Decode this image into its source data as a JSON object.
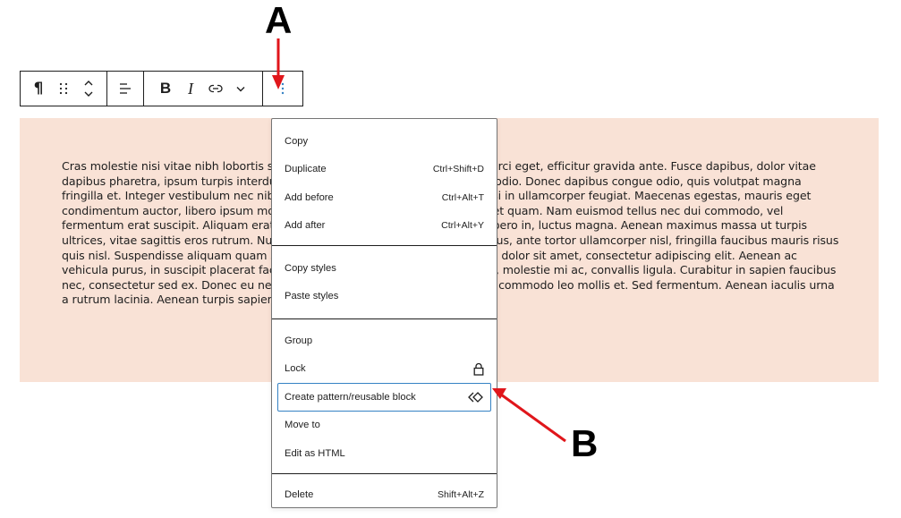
{
  "annotations": {
    "label_a": "A",
    "label_b": "B",
    "arrow_color": "#e0161b"
  },
  "toolbar": {
    "paragraph_icon": "pilcrow-icon",
    "paragraph_glyph": "¶",
    "drag_icon": "drag-handle-icon",
    "move_icon": "move-up-down-icon",
    "align_icon": "align-left-icon",
    "bold_label": "B",
    "italic_label": "I",
    "link_icon": "link-icon",
    "more_icon": "chevron-down-icon",
    "options_icon": "more-vertical-icon",
    "accent_color": "#3582c4"
  },
  "block": {
    "background": "#f9e2d6",
    "text": "Cras molestie nisi vitae nibh lobortis sodales. Nunc ut tincidunt odio. Proin in orci eget, efficitur gravida ante. Fusce dapibus, dolor vitae dapibus pharetra, ipsum turpis interdum justo, sit amet dictum purus nunc in odio. Donec dapibus congue odio, quis volutpat magna fringilla et. Integer vestibulum nec nibh ac mattis. Nunc dignissim, nunc ac nisi in ullamcorper feugiat. Maecenas egestas, mauris eget condimentum auctor, libero ipsum mollis nulla, nec tincidunt libero elit sit amet quam. Nam euismod tellus nec dui commodo, vel fermentum erat suscipit. Aliquam erat volutpat. Donec bibendum, interdum libero in, luctus magna. Aenean maximus massa ut turpis ultrices, vitae sagittis eros rutrum. Nulla tristique leo, libero et malesuada luctus, ante tortor ullamcorper nisl, fringilla faucibus mauris risus quis nisl. Suspendisse aliquam quam sollicitudin et pretium eros. Lorem ipsum dolor sit amet, consectetur adipiscing elit. Aenean ac vehicula purus, in suscipit placerat facilisis. Suspendisse tristique libero mollis, molestie mi ac, convallis ligula. Curabitur in sapien faucibus nec, consectetur sed ex. Donec eu neque massa. Sed fringilla congue velit, et commodo leo mollis et. Sed fermentum. Aenean iaculis urna a rutrum lacinia. Aenean turpis sapien, laoreet ut posuere id, venenatis at dui."
  },
  "menu": {
    "groups": [
      {
        "items": [
          {
            "label": "Copy",
            "shortcut": ""
          },
          {
            "label": "Duplicate",
            "shortcut": "Ctrl+Shift+D"
          },
          {
            "label": "Add before",
            "shortcut": "Ctrl+Alt+T"
          },
          {
            "label": "Add after",
            "shortcut": "Ctrl+Alt+Y"
          }
        ]
      },
      {
        "items": [
          {
            "label": "Copy styles",
            "shortcut": ""
          },
          {
            "label": "Paste styles",
            "shortcut": ""
          }
        ]
      },
      {
        "items": [
          {
            "label": "Group",
            "shortcut": ""
          },
          {
            "label": "Lock",
            "icon": "lock-icon"
          },
          {
            "label": "Create pattern/reusable block",
            "icon": "symbol-icon",
            "focused": true
          },
          {
            "label": "Move to",
            "shortcut": ""
          },
          {
            "label": "Edit as HTML",
            "shortcut": ""
          }
        ]
      },
      {
        "items": [
          {
            "label": "Delete",
            "shortcut": "Shift+Alt+Z"
          }
        ]
      }
    ]
  }
}
